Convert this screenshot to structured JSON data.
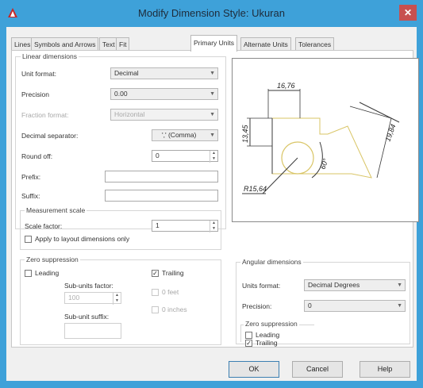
{
  "window": {
    "title": "Modify Dimension Style: Ukuran",
    "close_glyph": "✕",
    "app_icon": "autocad-logo-icon"
  },
  "tabs": [
    "Lines",
    "Symbols and Arrows",
    "Text",
    "Fit",
    "Primary Units",
    "Alternate Units",
    "Tolerances"
  ],
  "active_tab": "Primary Units",
  "linear": {
    "group_label": "Linear dimensions",
    "unit_format_label": "Unit format:",
    "unit_format_value": "Decimal",
    "precision_label": "Precision",
    "precision_value": "0.00",
    "fraction_format_label": "Fraction format:",
    "fraction_format_value": "Horizontal",
    "decimal_separator_label": "Decimal separator:",
    "decimal_separator_value": "',' (Comma)",
    "round_off_label": "Round off:",
    "round_off_value": "0",
    "prefix_label": "Prefix:",
    "prefix_value": "",
    "suffix_label": "Suffix:",
    "suffix_value": ""
  },
  "measurement": {
    "group_label": "Measurement scale",
    "scale_factor_label": "Scale factor:",
    "scale_factor_value": "1",
    "apply_layout_label": "Apply to layout dimensions only",
    "apply_layout_checked": false
  },
  "zero_linear": {
    "group_label": "Zero suppression",
    "leading_label": "Leading",
    "leading_checked": false,
    "trailing_label": "Trailing",
    "trailing_checked": true,
    "sub_units_factor_label": "Sub-units factor:",
    "sub_units_factor_value": "100",
    "zero_feet_label": "0 feet",
    "zero_inches_label": "0 inches",
    "sub_unit_suffix_label": "Sub-unit suffix:",
    "sub_unit_suffix_value": ""
  },
  "preview": {
    "dim_top": "16,76",
    "dim_left": "13,45",
    "dim_right": "19,84",
    "dim_angle": "60°",
    "dim_radius": "R15,64"
  },
  "angular": {
    "group_label": "Angular dimensions",
    "units_format_label": "Units format:",
    "units_format_value": "Decimal Degrees",
    "precision_label": "Precision:",
    "precision_value": "0",
    "zero_group_label": "Zero suppression",
    "leading_label": "Leading",
    "leading_checked": false,
    "trailing_label": "Trailing",
    "trailing_checked": true
  },
  "buttons": {
    "ok": "OK",
    "cancel": "Cancel",
    "help": "Help"
  },
  "glyphs": {
    "arrow_down": "▼",
    "spin_up": "▲",
    "spin_down": "▼",
    "check": "✓"
  },
  "colors": {
    "title_bar": "#3ea1d9",
    "close_button": "#c75050",
    "dialog_bg": "#f0f0f0",
    "preview_circle": "#d9c566",
    "preview_lines": "#3a3a3a"
  }
}
